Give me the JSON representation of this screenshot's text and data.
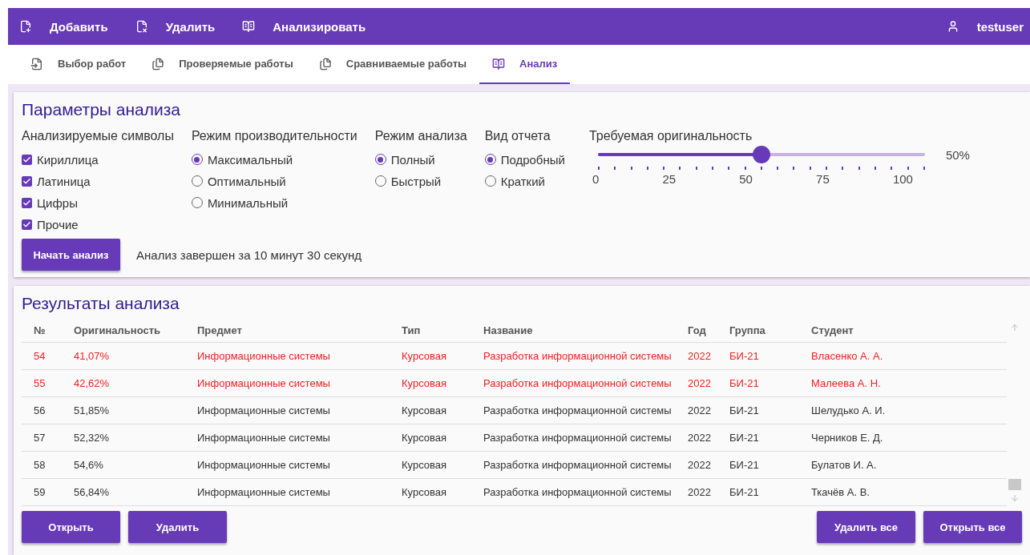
{
  "toolbar": {
    "actions": [
      {
        "label": "Добавить",
        "kind": "add"
      },
      {
        "label": "Удалить",
        "kind": "remove"
      },
      {
        "label": "Анализировать",
        "kind": "analyze"
      }
    ],
    "user": "testuser"
  },
  "tabs": [
    {
      "label": "Выбор работ",
      "kind": "select",
      "selected": false
    },
    {
      "label": "Проверяемые работы",
      "kind": "files",
      "selected": false
    },
    {
      "label": "Сравниваемые работы",
      "kind": "files",
      "selected": false
    },
    {
      "label": "Анализ",
      "kind": "analyze",
      "selected": true
    }
  ],
  "params": {
    "title": "Параметры анализа",
    "symbols": {
      "label": "Анализируемые символы",
      "options": [
        {
          "label": "Кириллица",
          "checked": true
        },
        {
          "label": "Латиница",
          "checked": true
        },
        {
          "label": "Цифры",
          "checked": true
        },
        {
          "label": "Прочие",
          "checked": true
        }
      ]
    },
    "radio_groups": [
      {
        "label": "Режим производительности",
        "options": [
          {
            "label": "Максимальный",
            "selected": true
          },
          {
            "label": "Оптимальный",
            "selected": false
          },
          {
            "label": "Минимальный",
            "selected": false
          }
        ]
      },
      {
        "label": "Режим анализа",
        "options": [
          {
            "label": "Полный",
            "selected": true
          },
          {
            "label": "Быстрый",
            "selected": false
          }
        ]
      },
      {
        "label": "Вид отчета",
        "options": [
          {
            "label": "Подробный",
            "selected": true
          },
          {
            "label": "Краткий",
            "selected": false
          }
        ]
      }
    ],
    "originality": {
      "label": "Требуемая оригинальность",
      "level": 0.5,
      "reading": "50%",
      "tick_labels": [
        "0",
        "25",
        "50",
        "75",
        "100"
      ]
    },
    "start_button": "Начать анализ",
    "status": "Анализ завершен за 10 минут 30 секунд"
  },
  "results": {
    "title": "Результаты анализа",
    "columns": [
      "№",
      "Оригинальность",
      "Предмет",
      "Тип",
      "Название",
      "Год",
      "Группа",
      "Студент"
    ],
    "rows": [
      {
        "highlighted": true,
        "cells": [
          "54",
          "41,07%",
          "Информационные системы",
          "Курсовая",
          "Разработка информационной системы",
          "2022",
          "БИ-21",
          "Власенко А. А."
        ]
      },
      {
        "highlighted": true,
        "cells": [
          "55",
          "42,62%",
          "Информационные системы",
          "Курсовая",
          "Разработка информационной системы",
          "2022",
          "БИ-21",
          "Малеева А. Н."
        ]
      },
      {
        "highlighted": false,
        "cells": [
          "56",
          "51,85%",
          "Информационные системы",
          "Курсовая",
          "Разработка информационной системы",
          "2022",
          "БИ-21",
          "Шелудько А. И."
        ]
      },
      {
        "highlighted": false,
        "cells": [
          "57",
          "52,32%",
          "Информационные системы",
          "Курсовая",
          "Разработка информационной системы",
          "2022",
          "БИ-21",
          "Черников Е. Д."
        ]
      },
      {
        "highlighted": false,
        "cells": [
          "58",
          "54,6%",
          "Информационные системы",
          "Курсовая",
          "Разработка информационной системы",
          "2022",
          "БИ-21",
          "Булатов И. А."
        ]
      },
      {
        "highlighted": false,
        "cells": [
          "59",
          "56,84%",
          "Информационные системы",
          "Курсовая",
          "Разработка информационной системы",
          "2022",
          "БИ-21",
          "Ткачёв А. В."
        ]
      }
    ],
    "left_buttons": [
      "Открыть",
      "Удалить"
    ],
    "right_buttons": [
      "Удалить все",
      "Открыть все"
    ]
  }
}
